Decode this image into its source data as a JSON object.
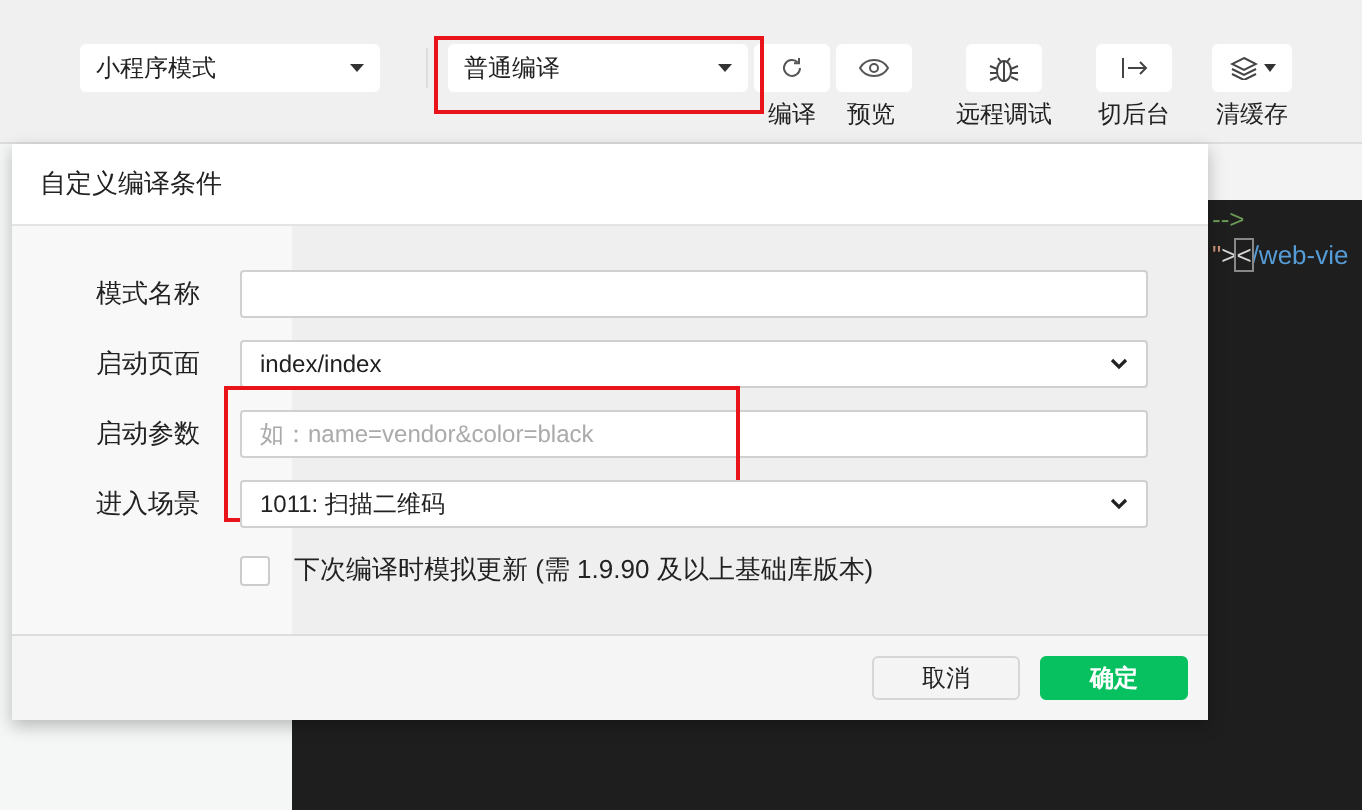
{
  "toolbar": {
    "mode_select": {
      "value": "小程序模式"
    },
    "compile_select": {
      "value": "普通编译",
      "highlighted": true
    },
    "buttons": [
      {
        "kind": "refresh",
        "label": "编译"
      },
      {
        "kind": "eye",
        "label": "预览"
      },
      {
        "kind": "bug",
        "label": "远程调试"
      },
      {
        "kind": "switch",
        "label": "切后台"
      },
      {
        "kind": "layers",
        "label": "清缓存"
      }
    ]
  },
  "editor": {
    "lines": [
      {
        "segments": [
          {
            "kind": "comment",
            "text": "-->"
          }
        ]
      },
      {
        "segments": [
          {
            "kind": "string",
            "text": "\""
          },
          {
            "kind": "plain",
            "text": ">"
          },
          {
            "kind": "cursor",
            "text": "<"
          },
          {
            "kind": "tag",
            "text": "/web-vie"
          }
        ]
      }
    ]
  },
  "dialog": {
    "title": "自定义编译条件",
    "fields": [
      {
        "kind": "input",
        "label": "模式名称"
      },
      {
        "kind": "select",
        "label": "启动页面",
        "value": "index/index"
      },
      {
        "kind": "input",
        "label": "启动参数",
        "placeholder": "如：name=vendor&color=black",
        "highlighted": true
      },
      {
        "kind": "select",
        "label": "进入场景",
        "value": "1011: 扫描二维码"
      }
    ],
    "checkbox": {
      "label": "下次编译时模拟更新 (需 1.9.90 及以上基础库版本)",
      "checked": false
    },
    "buttons": [
      {
        "label": "取消",
        "primary": false
      },
      {
        "label": "确定",
        "primary": true
      }
    ]
  }
}
